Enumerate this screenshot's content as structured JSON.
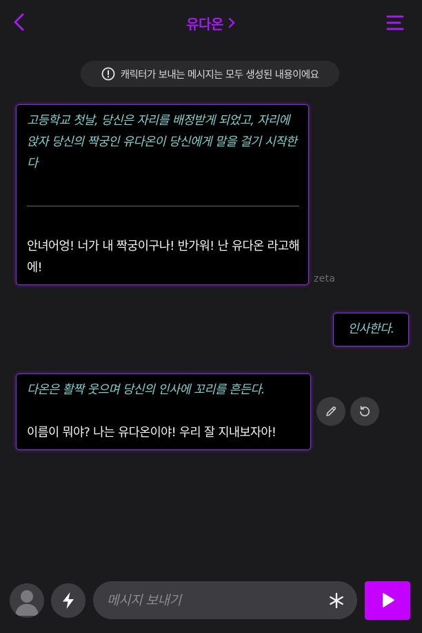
{
  "header": {
    "title": "유다온",
    "back_icon": "chevron-left-icon",
    "title_icon": "chevron-right-icon",
    "menu_icon": "menu-icon",
    "accent_color": "#a21cf0"
  },
  "notice": {
    "icon": "exclamation-circle-icon",
    "text": "캐릭터가 보내는 메시지는 모두 생성된 내용이에요"
  },
  "messages": [
    {
      "sender": "character",
      "narration": "고등학교 첫날, 당신은 자리를 배정받게 되었고, 자리에 앉자 당신의 짝궁인 유다온이 당신에게 말을 걸기 시작한다",
      "speech": "안녀어엉! 너가 내 짝궁이구나! 반가워! 난 유다온 라고해에!",
      "label": "zeta"
    },
    {
      "sender": "user",
      "narration": "인사한다."
    },
    {
      "sender": "character",
      "narration": "다온은 활짝 웃으며 당신의 인사에 꼬리를 흔든다.",
      "speech": "이름이 뭐야? 나는 유다온이야! 우리 잘 지내보자아!"
    }
  ],
  "actions": {
    "edit_icon": "pencil-icon",
    "regenerate_icon": "refresh-icon"
  },
  "composer": {
    "avatar_icon": "user-avatar-icon",
    "bolt_icon": "lightning-icon",
    "placeholder": "메시지 보내기",
    "value": "",
    "asterisk_icon": "asterisk-icon",
    "send_icon": "play-icon",
    "send_color": "#c400ff"
  },
  "colors": {
    "background": "#1b1a1c",
    "bubble_border": "#8a2be2",
    "narration": "#7fd2d0"
  }
}
